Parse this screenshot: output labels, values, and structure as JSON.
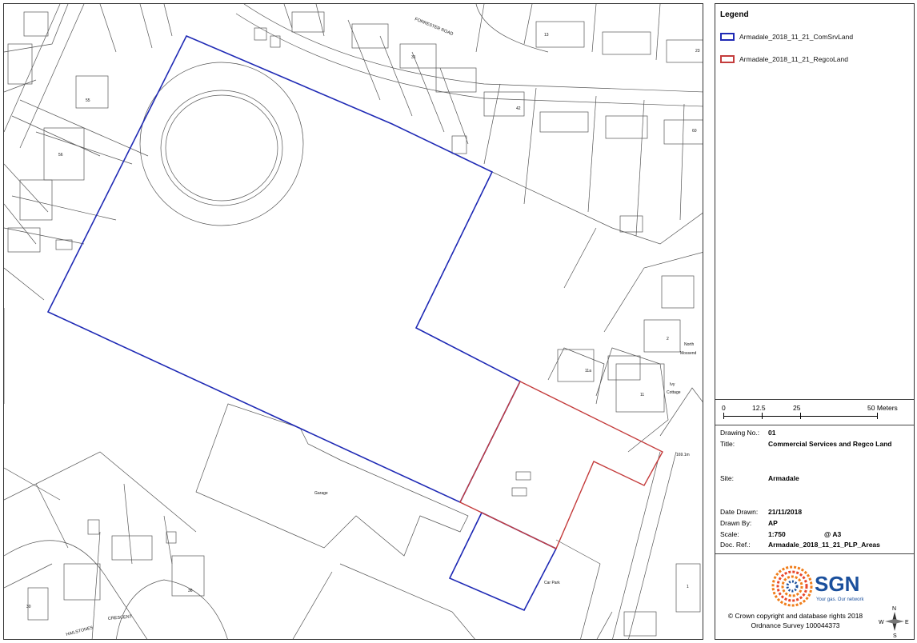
{
  "map": {
    "labels": {
      "forrester_road": "FORRESTER ROAD",
      "garage": "Garage",
      "car_park": "Car Park",
      "crescent": "CRESCENT",
      "hailstones": "HAILSTONES",
      "north": "North",
      "mossend": "Mossend",
      "ivy": "Ivy",
      "cottage": "Cottage",
      "spot_height": "169.1m",
      "n13": "13",
      "n23": "23",
      "n31": "31",
      "n42": "42",
      "n55": "55",
      "n56": "56",
      "n60": "60",
      "n30": "30",
      "n36": "36",
      "n11a": "11a",
      "n11": "11",
      "n2": "2",
      "n1": "1"
    },
    "colors": {
      "comsrv": "#1f2ab5",
      "regco": "#c43c3c",
      "lines": "#555555"
    }
  },
  "legend": {
    "title": "Legend",
    "items": [
      {
        "label": "Armadale_2018_11_21_ComSrvLand",
        "color": "#1f2ab5"
      },
      {
        "label": "Armadale_2018_11_21_RegcoLand",
        "color": "#c43c3c"
      }
    ]
  },
  "scale_bar": {
    "ticks": [
      "0",
      "12.5",
      "25",
      "50 Meters"
    ]
  },
  "drawing": {
    "number_label": "Drawing No.:",
    "number": "01",
    "title_label": "Title:",
    "title": "Commercial Services and Regco Land",
    "site_label": "Site:",
    "site": "Armadale",
    "date_label": "Date Drawn:",
    "date": "21/11/2018",
    "drawn_by_label": "Drawn By:",
    "drawn_by": "AP",
    "scale_label": "Scale:",
    "scale": "1:750",
    "paper": "@ A3",
    "docref_label": "Doc. Ref.:",
    "docref": "Armadale_2018_11_21_PLP_Areas"
  },
  "logo": {
    "name": "SGN",
    "tagline": "Your gas. Our network",
    "color": "#1a4f9c",
    "accent": "#f07d1a"
  },
  "copyright": {
    "line1": "© Crown copyright and database rights 2018",
    "line2": "Ordnance Survey 100044373"
  },
  "north_arrow": {
    "n": "N",
    "s": "S",
    "e": "E",
    "w": "W"
  }
}
